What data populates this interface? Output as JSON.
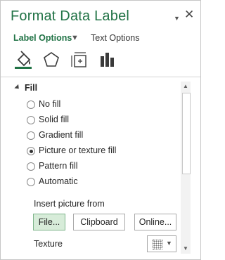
{
  "pane": {
    "title": "Format Data Label"
  },
  "header": {
    "dropdown_icon": "caret-down-icon",
    "close_icon": "close-icon"
  },
  "tabs": [
    {
      "label": "Label Options",
      "active": true
    },
    {
      "label": "Text Options",
      "active": false
    }
  ],
  "icon_tabs": [
    "fill-line-icon",
    "effects-pentagon-icon",
    "size-properties-icon",
    "label-options-bar-chart-icon"
  ],
  "fill_section": {
    "title": "Fill",
    "options": [
      {
        "label": "No fill",
        "selected": false
      },
      {
        "label": "Solid fill",
        "selected": false
      },
      {
        "label": "Gradient fill",
        "selected": false
      },
      {
        "label": "Picture or texture fill",
        "selected": true
      },
      {
        "label": "Pattern fill",
        "selected": false
      },
      {
        "label": "Automatic",
        "selected": false
      }
    ],
    "insert_picture_from": "Insert picture from",
    "buttons": {
      "file": "File...",
      "clipboard": "Clipboard",
      "online": "Online..."
    },
    "texture_label": "Texture"
  },
  "colors": {
    "accent": "#217346",
    "selected_button": "#d7ecd9"
  }
}
